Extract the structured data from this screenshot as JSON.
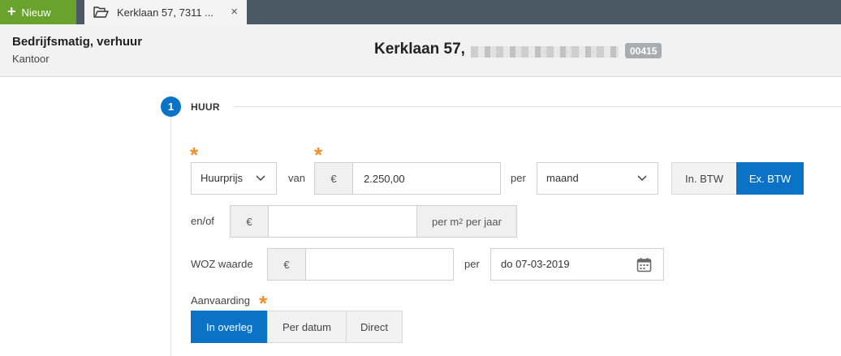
{
  "topbar": {
    "new_button_label": "Nieuw",
    "tab_label": "Kerklaan 57, 7311 ...",
    "tab_close": "×"
  },
  "header": {
    "property_type": "Bedrijfsmatig, verhuur",
    "property_subtype": "Kantoor",
    "address": "Kerklaan 57, ",
    "code": "00415"
  },
  "step": {
    "number": "1",
    "title": "HUUR"
  },
  "form": {
    "required_mark": "*",
    "price_type": "Huurprijs",
    "van_label": "van",
    "currency": "€",
    "amount": "2.250,00",
    "per_label": "per",
    "period": "maand",
    "btw_incl": "In. BTW",
    "btw_excl": "Ex. BTW",
    "btw_selected": "Ex. BTW",
    "enof_label": "en/of",
    "sqm_amount": "",
    "sqm_suffix_prefix": "per m",
    "sqm_suffix_sup": "2",
    "sqm_suffix_rest": " per jaar",
    "woz_label": "WOZ waarde",
    "woz_amount": "",
    "woz_per_label": "per",
    "woz_date": "do 07-03-2019",
    "aanvaarding_label": "Aanvaarding",
    "aanvaarding_options": [
      "In overleg",
      "Per datum",
      "Direct"
    ],
    "aanvaarding_selected": "In overleg"
  },
  "colors": {
    "primary": "#0a73c6",
    "new_button": "#6aa22e",
    "topbar": "#4a5963",
    "required": "#f0902a"
  },
  "icons": {
    "new": "plus-icon",
    "tab": "folder-open-icon",
    "close": "close-icon",
    "select": "chevron-down-icon",
    "date": "calendar-icon"
  }
}
